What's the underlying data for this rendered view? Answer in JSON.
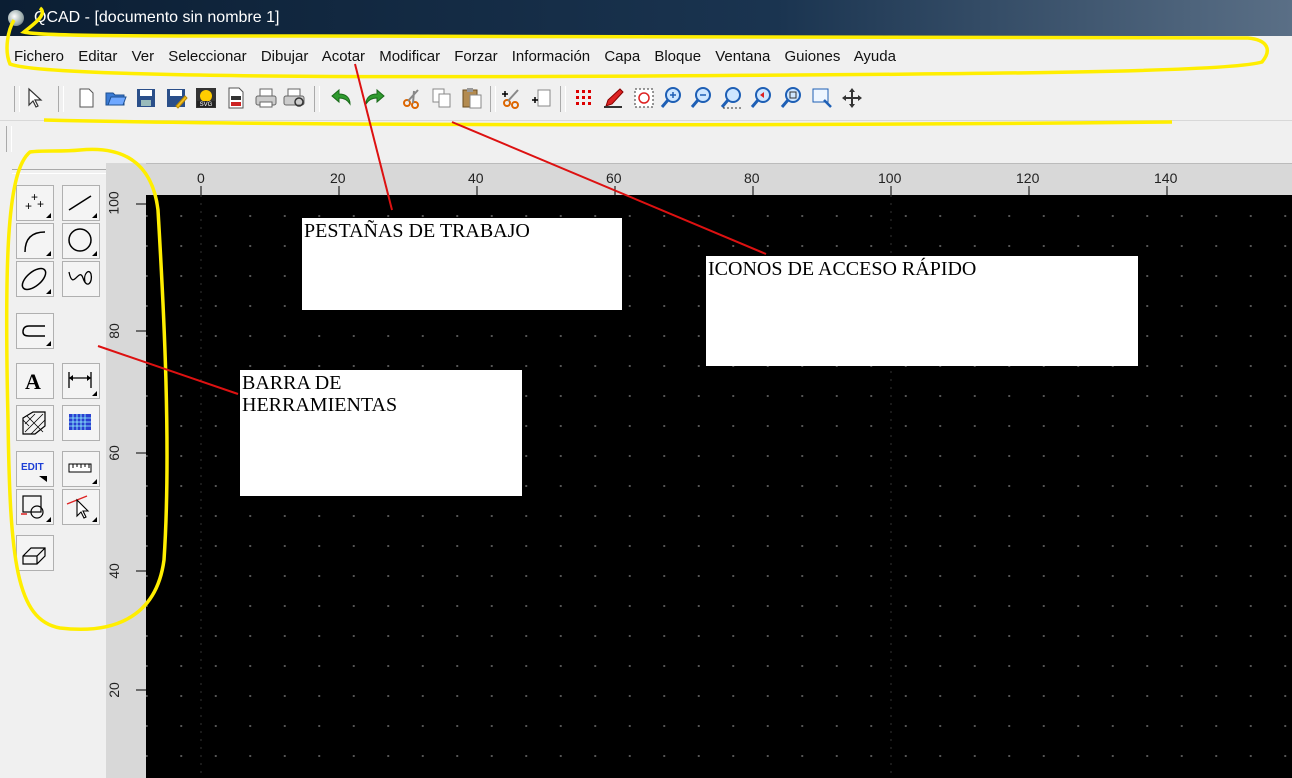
{
  "window": {
    "title": "QCAD - [documento sin nombre 1]"
  },
  "menu": {
    "items": [
      "Fichero",
      "Editar",
      "Ver",
      "Seleccionar",
      "Dibujar",
      "Acotar",
      "Modificar",
      "Forzar",
      "Información",
      "Capa",
      "Bloque",
      "Ventana",
      "Guiones",
      "Ayuda"
    ]
  },
  "toolbar": {
    "icons": [
      "select-pointer-icon",
      "new-file-icon",
      "open-folder-icon",
      "save-icon",
      "save-as-icon",
      "export-svg-icon",
      "export-pdf-icon",
      "print-icon",
      "print-preview-icon",
      "undo-icon",
      "redo-icon",
      "cut-icon",
      "copy-icon",
      "paste-icon",
      "cut-reference-icon",
      "copy-reference-icon",
      "grid-toggle-icon",
      "draft-mode-icon",
      "redraw-icon",
      "zoom-in-icon",
      "zoom-out-icon",
      "zoom-auto-icon",
      "zoom-previous-icon",
      "zoom-window-icon",
      "zoom-selection-icon",
      "pan-icon"
    ]
  },
  "ruler": {
    "horizontal": [
      "0",
      "20",
      "40",
      "60",
      "80",
      "100",
      "120",
      "140"
    ],
    "vertical": [
      "100",
      "80",
      "60",
      "40",
      "20"
    ]
  },
  "tools": {
    "edit_label": "EDIT"
  },
  "annotations": {
    "tabs": "PESTAÑAS DE TRABAJO",
    "quick_icons": "ICONOS DE ACCESO RÁPIDO",
    "toolbar_line1": "BARRA DE",
    "toolbar_line2": "HERRAMIENTAS"
  },
  "colors": {
    "highlight": "#ffee00",
    "pointer_line": "#dd1111",
    "canvas": "#000000"
  }
}
